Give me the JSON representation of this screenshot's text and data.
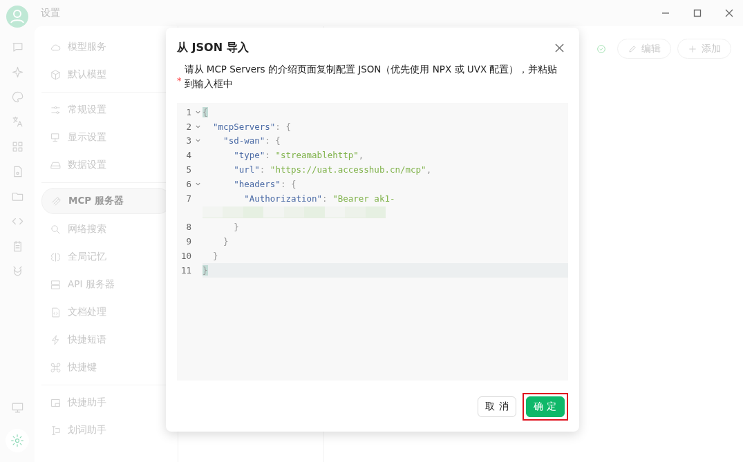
{
  "window": {
    "title": "设置"
  },
  "rail": {
    "items": [
      {
        "selected": false
      },
      {
        "selected": false
      },
      {
        "selected": false
      },
      {
        "selected": false
      },
      {
        "selected": false
      },
      {
        "selected": false
      },
      {
        "selected": false
      },
      {
        "selected": false
      },
      {
        "selected": false
      },
      {
        "selected": false
      }
    ],
    "bottom": [
      {
        "selected": false
      },
      {
        "selected": true
      }
    ]
  },
  "sidebar": {
    "groups": [
      {
        "items": [
          {
            "label": "模型服务",
            "selected": false
          },
          {
            "label": "默认模型",
            "selected": false
          }
        ]
      },
      {
        "items": [
          {
            "label": "常规设置",
            "selected": false
          },
          {
            "label": "显示设置",
            "selected": false
          },
          {
            "label": "数据设置",
            "selected": false
          }
        ]
      },
      {
        "items": [
          {
            "label": "MCP 服务器",
            "selected": true
          },
          {
            "label": "网络搜索",
            "selected": false
          },
          {
            "label": "全局记忆",
            "selected": false
          },
          {
            "label": "API 服务器",
            "selected": false
          },
          {
            "label": "文档处理",
            "selected": false
          },
          {
            "label": "快捷短语",
            "selected": false
          },
          {
            "label": "快捷键",
            "selected": false
          }
        ]
      },
      {
        "items": [
          {
            "label": "快捷助手",
            "selected": false
          },
          {
            "label": "划词助手",
            "selected": false
          }
        ]
      }
    ]
  },
  "toolbar": {
    "buttons": [
      {
        "kind": "edit",
        "label": "编辑"
      },
      {
        "kind": "add",
        "label": "添加"
      }
    ]
  },
  "dialog": {
    "title": "从 JSON 导入",
    "required_mark": "*",
    "description": "请从 MCP Servers 的介绍页面复制配置 JSON（优先使用 NPX 或 UVX 配置），并粘贴到输入框中",
    "editor": {
      "lines": [
        {
          "number": "1",
          "foldable": true,
          "active": false,
          "tokens": [
            {
              "kind": "punct",
              "text": "{",
              "matched": true
            }
          ]
        },
        {
          "number": "2",
          "foldable": true,
          "active": false,
          "tokens": [
            {
              "kind": "key",
              "text": "  \"mcpServers\"",
              "matched": false
            },
            {
              "kind": "punct",
              "text": ": {",
              "matched": false
            }
          ]
        },
        {
          "number": "3",
          "foldable": true,
          "active": false,
          "tokens": [
            {
              "kind": "key",
              "text": "    \"sd-wan\"",
              "matched": false
            },
            {
              "kind": "punct",
              "text": ": {",
              "matched": false
            }
          ]
        },
        {
          "number": "4",
          "foldable": false,
          "active": false,
          "tokens": [
            {
              "kind": "key",
              "text": "      \"type\"",
              "matched": false
            },
            {
              "kind": "punct",
              "text": ": ",
              "matched": false
            },
            {
              "kind": "string",
              "text": "\"streamablehttp\"",
              "matched": false
            },
            {
              "kind": "punct",
              "text": ",",
              "matched": false
            }
          ]
        },
        {
          "number": "5",
          "foldable": false,
          "active": false,
          "tokens": [
            {
              "kind": "key",
              "text": "      \"url\"",
              "matched": false
            },
            {
              "kind": "punct",
              "text": ": ",
              "matched": false
            },
            {
              "kind": "string",
              "text": "\"https://uat.accesshub.cn/mcp\"",
              "matched": false
            },
            {
              "kind": "punct",
              "text": ",",
              "matched": false
            }
          ]
        },
        {
          "number": "6",
          "foldable": true,
          "active": false,
          "tokens": [
            {
              "kind": "key",
              "text": "      \"headers\"",
              "matched": false
            },
            {
              "kind": "punct",
              "text": ": {",
              "matched": false
            }
          ]
        },
        {
          "number": "7",
          "foldable": false,
          "active": false,
          "redacted": true,
          "tokens": [
            {
              "kind": "key",
              "text": "        \"Authorization\"",
              "matched": false
            },
            {
              "kind": "punct",
              "text": ": ",
              "matched": false
            },
            {
              "kind": "string",
              "text": "\"Bearer ak1-",
              "matched": false
            }
          ]
        },
        {
          "number": "8",
          "foldable": false,
          "active": false,
          "tokens": [
            {
              "kind": "punct",
              "text": "      }",
              "matched": false
            }
          ]
        },
        {
          "number": "9",
          "foldable": false,
          "active": false,
          "tokens": [
            {
              "kind": "punct",
              "text": "    }",
              "matched": false
            }
          ]
        },
        {
          "number": "10",
          "foldable": false,
          "active": false,
          "tokens": [
            {
              "kind": "punct",
              "text": "  }",
              "matched": false
            }
          ]
        },
        {
          "number": "11",
          "foldable": false,
          "active": true,
          "tokens": [
            {
              "kind": "punct",
              "text": "}",
              "matched": true
            }
          ]
        }
      ]
    },
    "buttons": [
      {
        "kind": "cancel",
        "label": "取 消",
        "highlighted": false
      },
      {
        "kind": "primary",
        "label": "确 定",
        "highlighted": true
      }
    ]
  }
}
